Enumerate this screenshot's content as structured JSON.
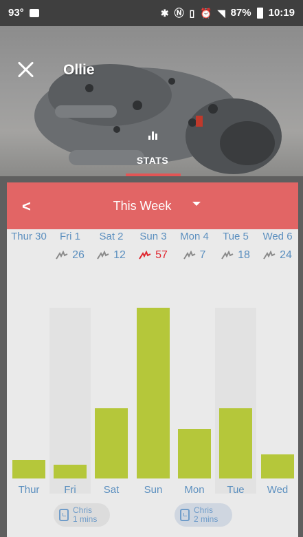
{
  "status_bar": {
    "temperature": "93°",
    "battery": "87%",
    "time": "10:19",
    "icons": [
      "image-icon",
      "bluetooth-icon",
      "nfc-icon",
      "vibrate-icon",
      "alarm-icon",
      "wifi-icon",
      "signal-icon",
      "battery-icon"
    ]
  },
  "header": {
    "pet_name": "Ollie",
    "tab_label": "STATS"
  },
  "week": {
    "title": "This Week"
  },
  "days": [
    {
      "header": "Thur 30",
      "count": "",
      "short": "Thur",
      "level": 0.11
    },
    {
      "header": "Fri 1",
      "count": "26",
      "short": "Fri",
      "level": 0.08
    },
    {
      "header": "Sat 2",
      "count": "12",
      "short": "Sat",
      "level": 0.41
    },
    {
      "header": "Sun 3",
      "count": "57",
      "short": "Sun",
      "level": 1.0
    },
    {
      "header": "Mon 4",
      "count": "7",
      "short": "Mon",
      "level": 0.29
    },
    {
      "header": "Tue 5",
      "count": "18",
      "short": "Tue",
      "level": 0.41
    },
    {
      "header": "Wed 6",
      "count": "24",
      "short": "Wed",
      "level": 0.14
    }
  ],
  "walks": [
    {
      "walker": "Chris",
      "duration": "1 mins"
    },
    {
      "walker": "Chris",
      "duration": "2 mins"
    }
  ],
  "colors": {
    "accent": "#e26565",
    "bar": "#b5c73a",
    "day_text": "#5b8fbf",
    "highlight": "#e0262f"
  }
}
